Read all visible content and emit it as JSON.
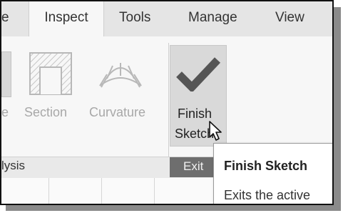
{
  "tabs": {
    "partial_left": "e",
    "inspect": "Inspect",
    "tools": "Tools",
    "manage": "Manage",
    "view": "View"
  },
  "ribbon": {
    "partial_label": "e",
    "section_label": "Section",
    "curvature_label": "Curvature",
    "finish_line1": "Finish",
    "finish_line2": "Sketch",
    "group_analysis_partial": "lysis",
    "group_exit_partial": "Exit"
  },
  "tooltip": {
    "title": "Finish Sketch",
    "description": "Exits the active"
  },
  "colors": {
    "checkmark": "#555555",
    "disabled_icon": "#b8b8b8",
    "exit_group_bg": "#6e6e6e"
  },
  "icons": [
    "section-icon",
    "curvature-icon",
    "checkmark-icon",
    "cursor-icon"
  ]
}
